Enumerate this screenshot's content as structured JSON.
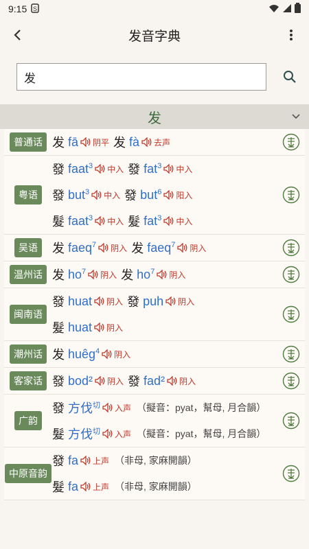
{
  "status": {
    "time": "9:15"
  },
  "appbar": {
    "title": "发音字典"
  },
  "search": {
    "value": "发"
  },
  "charbar": {
    "character": "发"
  },
  "rows": [
    {
      "dialect": "普通话",
      "lines": [
        [
          {
            "hz": "发",
            "py": "fā",
            "sup": "",
            "tone": "阴平"
          },
          {
            "hz": "发",
            "py": "fà",
            "sup": "",
            "tone": "去声"
          }
        ]
      ]
    },
    {
      "dialect": "粤语",
      "lines": [
        [
          {
            "hz": "發",
            "py": "faat",
            "sup": "3",
            "tone": "中入"
          },
          {
            "hz": "發",
            "py": "fat",
            "sup": "3",
            "tone": "中入"
          }
        ],
        [
          {
            "hz": "發",
            "py": "but",
            "sup": "3",
            "tone": "中入"
          },
          {
            "hz": "發",
            "py": "but",
            "sup": "6",
            "tone": "阳入"
          }
        ],
        [
          {
            "hz": "髮",
            "py": "faat",
            "sup": "3",
            "tone": "中入"
          },
          {
            "hz": "髮",
            "py": "fat",
            "sup": "3",
            "tone": "中入"
          }
        ]
      ]
    },
    {
      "dialect": "吴语",
      "lines": [
        [
          {
            "hz": "发",
            "py": "faeq",
            "sup": "7",
            "tone": "阴入"
          },
          {
            "hz": "发",
            "py": "faeq",
            "sup": "7",
            "tone": "阴入"
          }
        ]
      ]
    },
    {
      "dialect": "温州话",
      "lines": [
        [
          {
            "hz": "发",
            "py": "ho",
            "sup": "7",
            "tone": "阴入"
          },
          {
            "hz": "发",
            "py": "ho",
            "sup": "7",
            "tone": "阴入"
          }
        ]
      ]
    },
    {
      "dialect": "闽南语",
      "lines": [
        [
          {
            "hz": "發",
            "py": "huat",
            "sup": "",
            "tone": "阴入"
          },
          {
            "hz": "發",
            "py": "puh",
            "sup": "",
            "tone": "阴入"
          }
        ],
        [
          {
            "hz": "髮",
            "py": "huat",
            "sup": "",
            "tone": "阴入"
          }
        ]
      ]
    },
    {
      "dialect": "潮州话",
      "lines": [
        [
          {
            "hz": "发",
            "py": "huêg",
            "sup": "4",
            "tone": "阴入"
          }
        ]
      ]
    },
    {
      "dialect": "客家话",
      "lines": [
        [
          {
            "hz": "發",
            "py": "bod²",
            "sup": "",
            "tone": "阴入"
          },
          {
            "hz": "發",
            "py": "fad²",
            "sup": "",
            "tone": "阴入"
          }
        ]
      ]
    },
    {
      "dialect": "广韵",
      "lines": [
        [
          {
            "hz": "發",
            "py": "方伐",
            "sup": "切",
            "tone": "入声",
            "note": "（擬音：pyat，幫母, 月合韻）"
          }
        ],
        [
          {
            "hz": "髮",
            "py": "方伐",
            "sup": "切",
            "tone": "入声",
            "note": "（擬音：pyat，幫母, 月合韻）"
          }
        ]
      ]
    },
    {
      "dialect": "中原音韵",
      "lines": [
        [
          {
            "hz": "發",
            "py": "fa",
            "sup": "",
            "tone": "上声",
            "note": "（非母, 家麻開韻）"
          }
        ],
        [
          {
            "hz": "髮",
            "py": "fa",
            "sup": "",
            "tone": "上声",
            "note": "（非母, 家麻開韻）"
          }
        ]
      ]
    }
  ]
}
